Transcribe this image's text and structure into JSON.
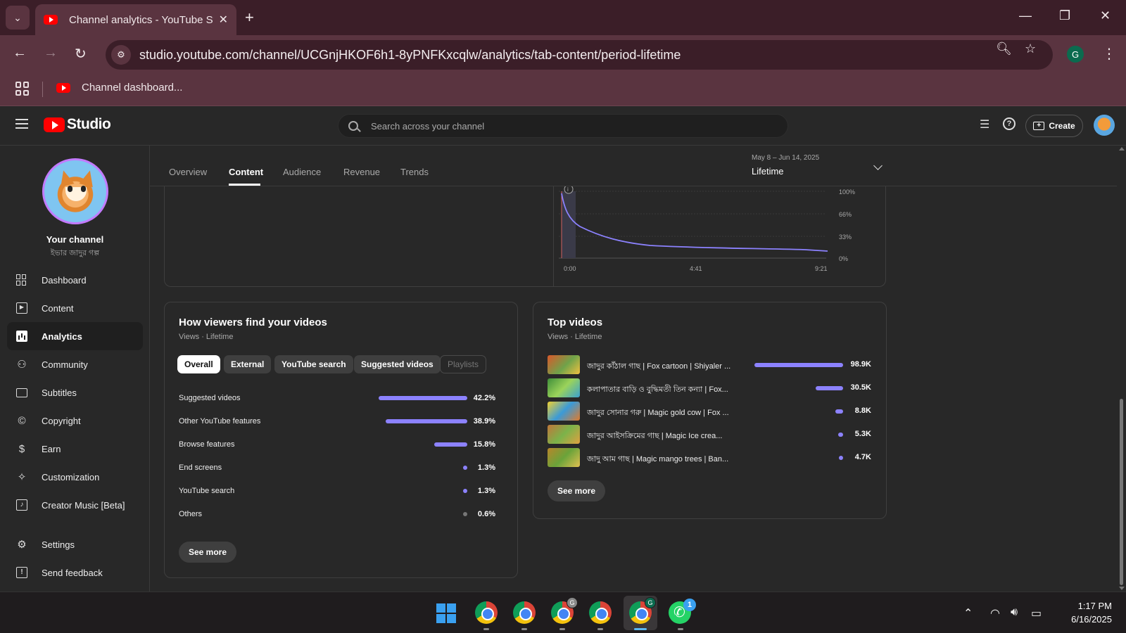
{
  "browser": {
    "tab_title": "Channel analytics - YouTube Studio",
    "url": "studio.youtube.com/channel/UCGnjHKOF6h1-8yPNFKxcqlw/analytics/tab-content/period-lifetime",
    "bookmark": "Channel dashboard...",
    "profile_letter": "G"
  },
  "header": {
    "logo_text": "Studio",
    "search_placeholder": "Search across your channel",
    "create_label": "Create"
  },
  "sidebar": {
    "channel_title": "Your channel",
    "channel_name": "ইভার জাদুর গল্প",
    "items": [
      {
        "label": "Dashboard",
        "icon": "dashboard-icon"
      },
      {
        "label": "Content",
        "icon": "content-icon"
      },
      {
        "label": "Analytics",
        "icon": "analytics-icon",
        "active": true
      },
      {
        "label": "Community",
        "icon": "community-icon"
      },
      {
        "label": "Subtitles",
        "icon": "subtitles-icon"
      },
      {
        "label": "Copyright",
        "icon": "copyright-icon"
      },
      {
        "label": "Earn",
        "icon": "dollar-icon"
      },
      {
        "label": "Customization",
        "icon": "wand-icon"
      },
      {
        "label": "Creator Music [Beta]",
        "icon": "music-icon"
      }
    ],
    "footer": [
      {
        "label": "Settings",
        "icon": "gear-icon"
      },
      {
        "label": "Send feedback",
        "icon": "feedback-icon"
      }
    ]
  },
  "analytics": {
    "tabs": [
      "Overview",
      "Content",
      "Audience",
      "Revenue",
      "Trends"
    ],
    "active_tab": "Content",
    "period_range": "May 8 – Jun 14, 2025",
    "period_value": "Lifetime"
  },
  "retention": {
    "y_ticks": [
      "100%",
      "66%",
      "33%",
      "0%"
    ],
    "x_ticks": [
      "0:00",
      "4:41",
      "9:21"
    ],
    "info_icon": "info-icon"
  },
  "traffic": {
    "title": "How viewers find your videos",
    "subtitle": "Views · Lifetime",
    "chips": [
      "Overall",
      "External",
      "YouTube search",
      "Suggested videos",
      "Playlists"
    ],
    "rows": [
      {
        "label": "Suggested videos",
        "value": "42.2%",
        "pct": 42.2
      },
      {
        "label": "Other YouTube features",
        "value": "38.9%",
        "pct": 38.9
      },
      {
        "label": "Browse features",
        "value": "15.8%",
        "pct": 15.8
      },
      {
        "label": "End screens",
        "value": "1.3%",
        "pct": 1.3
      },
      {
        "label": "YouTube search",
        "value": "1.3%",
        "pct": 1.3
      },
      {
        "label": "Others",
        "value": "0.6%",
        "pct": 0.6
      }
    ],
    "see_more": "See more"
  },
  "top_videos": {
    "title": "Top videos",
    "subtitle": "Views · Lifetime",
    "rows": [
      {
        "title": "জাদুর কাঁঠাল গাছ | Fox cartoon | Shiyaler ...",
        "value": "98.9K",
        "views": 98900
      },
      {
        "title": "কলাপাতার বাড়ি ও বুদ্ধিমতী তিন কন্যা | Fox...",
        "value": "30.5K",
        "views": 30500
      },
      {
        "title": "জাদুর সোনার গরু | Magic gold cow | Fox ...",
        "value": "8.8K",
        "views": 8800
      },
      {
        "title": "জাদুর আইসক্রিমের গাছ | Magic Ice crea...",
        "value": "5.3K",
        "views": 5300
      },
      {
        "title": "জাদু আম গাছ | Magic mango trees | Ban...",
        "value": "4.7K",
        "views": 4700
      }
    ],
    "see_more": "See more"
  },
  "taskbar": {
    "time": "1:17 PM",
    "date": "6/16/2025",
    "whatsapp_badge": "1",
    "chrome_badges": [
      "",
      "",
      "G",
      "",
      "G"
    ]
  },
  "colors": {
    "accent_bar": "#8c82ff",
    "browser_frame": "#5a3440",
    "studio_bg": "#282828"
  }
}
